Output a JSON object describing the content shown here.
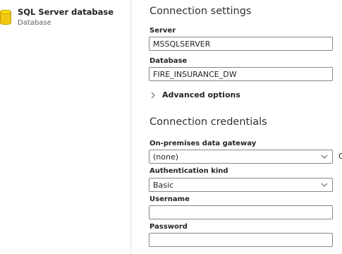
{
  "data_source": {
    "name": "SQL Server database",
    "subtitle": "Database",
    "icon": "database-cylinder-icon",
    "icon_color": "#f2c811"
  },
  "connection_settings": {
    "title": "Connection settings",
    "server": {
      "label": "Server",
      "value": "MSSQLSERVER"
    },
    "database": {
      "label": "Database",
      "value": "FIRE_INSURANCE_DW"
    },
    "advanced_options": {
      "label": "Advanced options",
      "icon": "chevron-right-icon"
    }
  },
  "connection_credentials": {
    "title": "Connection credentials",
    "gateway": {
      "label": "On-premises data gateway",
      "value": "(none)",
      "icon": "chevron-down-icon"
    },
    "auth_kind": {
      "label": "Authentication kind",
      "value": "Basic",
      "icon": "chevron-down-icon"
    },
    "username": {
      "label": "Username",
      "value": ""
    },
    "password": {
      "label": "Password",
      "value": ""
    }
  },
  "edge_glyph": "C"
}
